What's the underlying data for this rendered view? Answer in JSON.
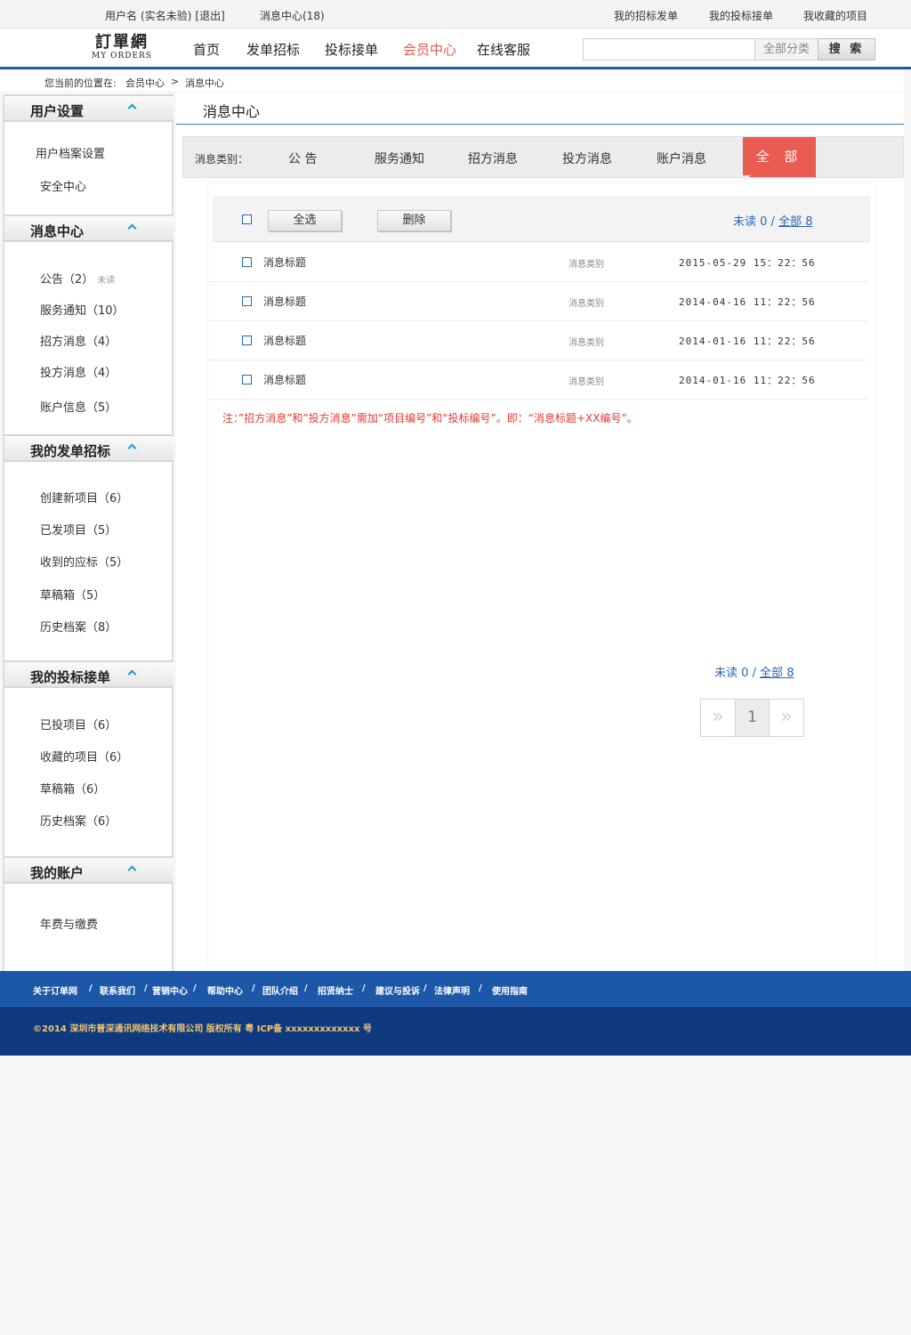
{
  "topbar": {
    "username": "用户名",
    "verify_status": "(实名未验)",
    "logout": "[退出]",
    "message_center": "消息中心(18)",
    "links": [
      "我的招标发单",
      "我的投标接单",
      "我收藏的项目"
    ]
  },
  "logo": {
    "cn": "訂單網",
    "en": "MY ORDERS"
  },
  "nav": {
    "items": [
      "首页",
      "发单招标",
      "投标接单",
      "会员中心",
      "在线客服"
    ],
    "active": "会员中心"
  },
  "search": {
    "placeholder": "",
    "category": "全部分类",
    "button": "搜 索"
  },
  "breadcrumb": {
    "prefix": "您当前的位置在:",
    "level1": "会员中心",
    "sep": ">",
    "level2": "消息中心"
  },
  "sidebar": {
    "sections": [
      {
        "title": "用户设置",
        "items": [
          "用户档案设置",
          "安全中心"
        ]
      },
      {
        "title": "消息中心",
        "items": [
          "公告（2）",
          "服务通知（10）",
          "招方消息（4）",
          "投方消息（4）",
          "账户信息（5）"
        ],
        "unread_label": "未读"
      },
      {
        "title": "我的发单招标",
        "items": [
          "创建新项目（6）",
          "已发项目（5）",
          "收到的应标（5）",
          "草稿箱（5）",
          "历史档案（8）"
        ]
      },
      {
        "title": "我的投标接单",
        "items": [
          "已投项目（6）",
          "收藏的项目（6）",
          "草稿箱（6）",
          "历史档案（6）"
        ]
      },
      {
        "title": "我的账户",
        "items": [
          "年费与缴费"
        ]
      }
    ]
  },
  "main": {
    "title": "消息中心",
    "tabs_label": "消息类别：",
    "tabs": [
      "公 告",
      "服务通知",
      "招方消息",
      "投方消息",
      "账户消息"
    ],
    "active_tab": "全 部",
    "select_all": "全选",
    "delete": "删除",
    "unread_text": "未读 0 /",
    "all_text": "全部 8",
    "messages": [
      {
        "title": "消息标题",
        "category": "消息类别",
        "date": "2015-05-29 15：22：56"
      },
      {
        "title": "消息标题",
        "category": "消息类别",
        "date": "2014-04-16 11：22：56"
      },
      {
        "title": "消息标题",
        "category": "消息类别",
        "date": "2014-01-16 11：22：56"
      },
      {
        "title": "消息标题",
        "category": "消息类别",
        "date": "2014-01-16 11：22：56"
      }
    ],
    "note": "注：”招方消息”和”投方消息”需加“项目编号”和“投标编号”。即：“消息标题+XX编号”。",
    "pagination": {
      "prev": "»",
      "page": "1",
      "next": "»"
    }
  },
  "footer": {
    "links": [
      "关于订单网",
      "/",
      "联系我们",
      "/",
      "营销中心",
      "/",
      "帮助中心",
      "/",
      "团队介绍",
      "/",
      "招贤纳士",
      "/",
      "建议与投诉",
      "/",
      "法律声明",
      "/",
      "使用指南"
    ],
    "copyright": "©2014 深圳市普深通讯网络技术有限公司 版权所有 粤 ICP备 xxxxxxxxxxxxx 号"
  }
}
